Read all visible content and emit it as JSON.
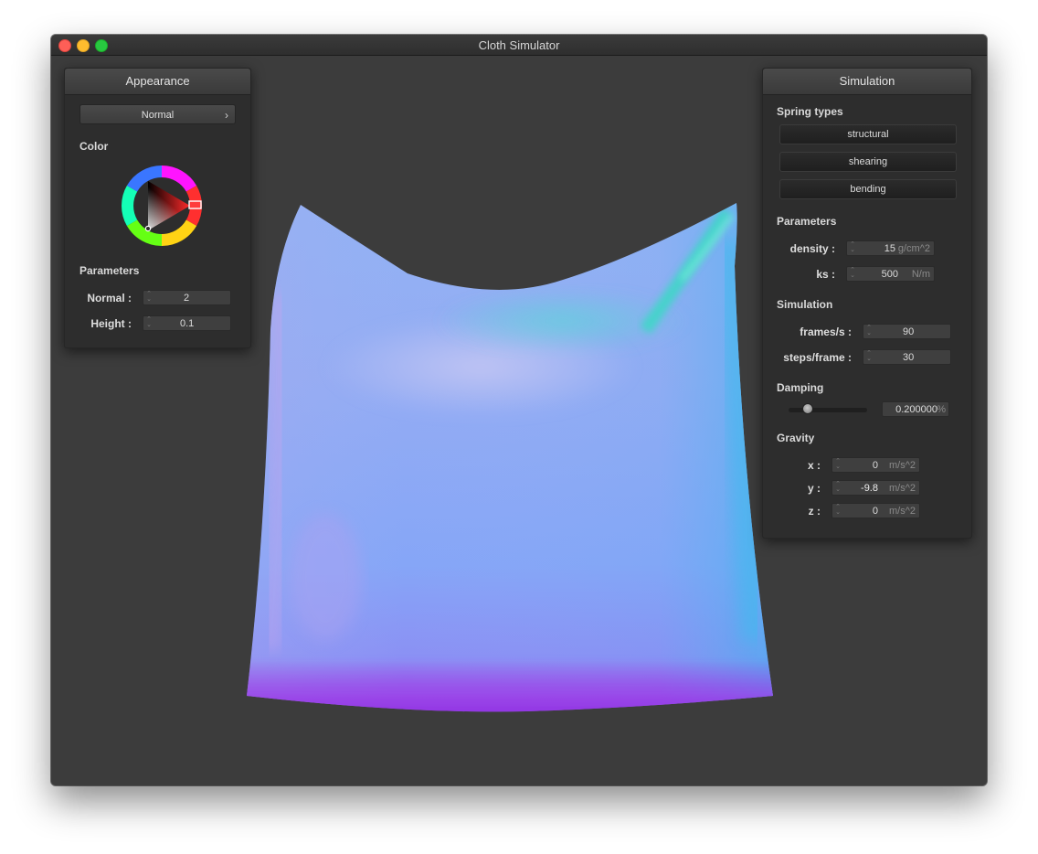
{
  "window": {
    "title": "Cloth Simulator"
  },
  "appearance": {
    "title": "Appearance",
    "shader_selected": "Normal",
    "color_label": "Color",
    "parameters_label": "Parameters",
    "normal": {
      "label": "Normal :",
      "value": "2"
    },
    "height": {
      "label": "Height :",
      "value": "0.1"
    }
  },
  "simulation_panel": {
    "title": "Simulation",
    "spring_types_label": "Spring types",
    "spring_types": [
      "structural",
      "shearing",
      "bending"
    ],
    "parameters_label": "Parameters",
    "density": {
      "label": "density :",
      "value": "15",
      "unit": "g/cm^2"
    },
    "ks": {
      "label": "ks :",
      "value": "500",
      "unit": "N/m"
    },
    "simulation_label": "Simulation",
    "frames_per_s": {
      "label": "frames/s :",
      "value": "90"
    },
    "steps_per_frame": {
      "label": "steps/frame :",
      "value": "30"
    },
    "damping_label": "Damping",
    "damping": {
      "value": "0.200000",
      "unit": "%",
      "slider_fraction": 0.2
    },
    "gravity_label": "Gravity",
    "gravity": [
      {
        "label": "x :",
        "value": "0",
        "unit": "m/s^2"
      },
      {
        "label": "y :",
        "value": "-9.8",
        "unit": "m/s^2"
      },
      {
        "label": "z :",
        "value": "0",
        "unit": "m/s^2"
      }
    ]
  },
  "colors": {
    "background": "#3c3c3c",
    "panel": "#2d2d2d",
    "cloth_blue": "#86a6f7",
    "cloth_cyan": "#3fd6c8",
    "cloth_purple": "#9a3ee8"
  }
}
